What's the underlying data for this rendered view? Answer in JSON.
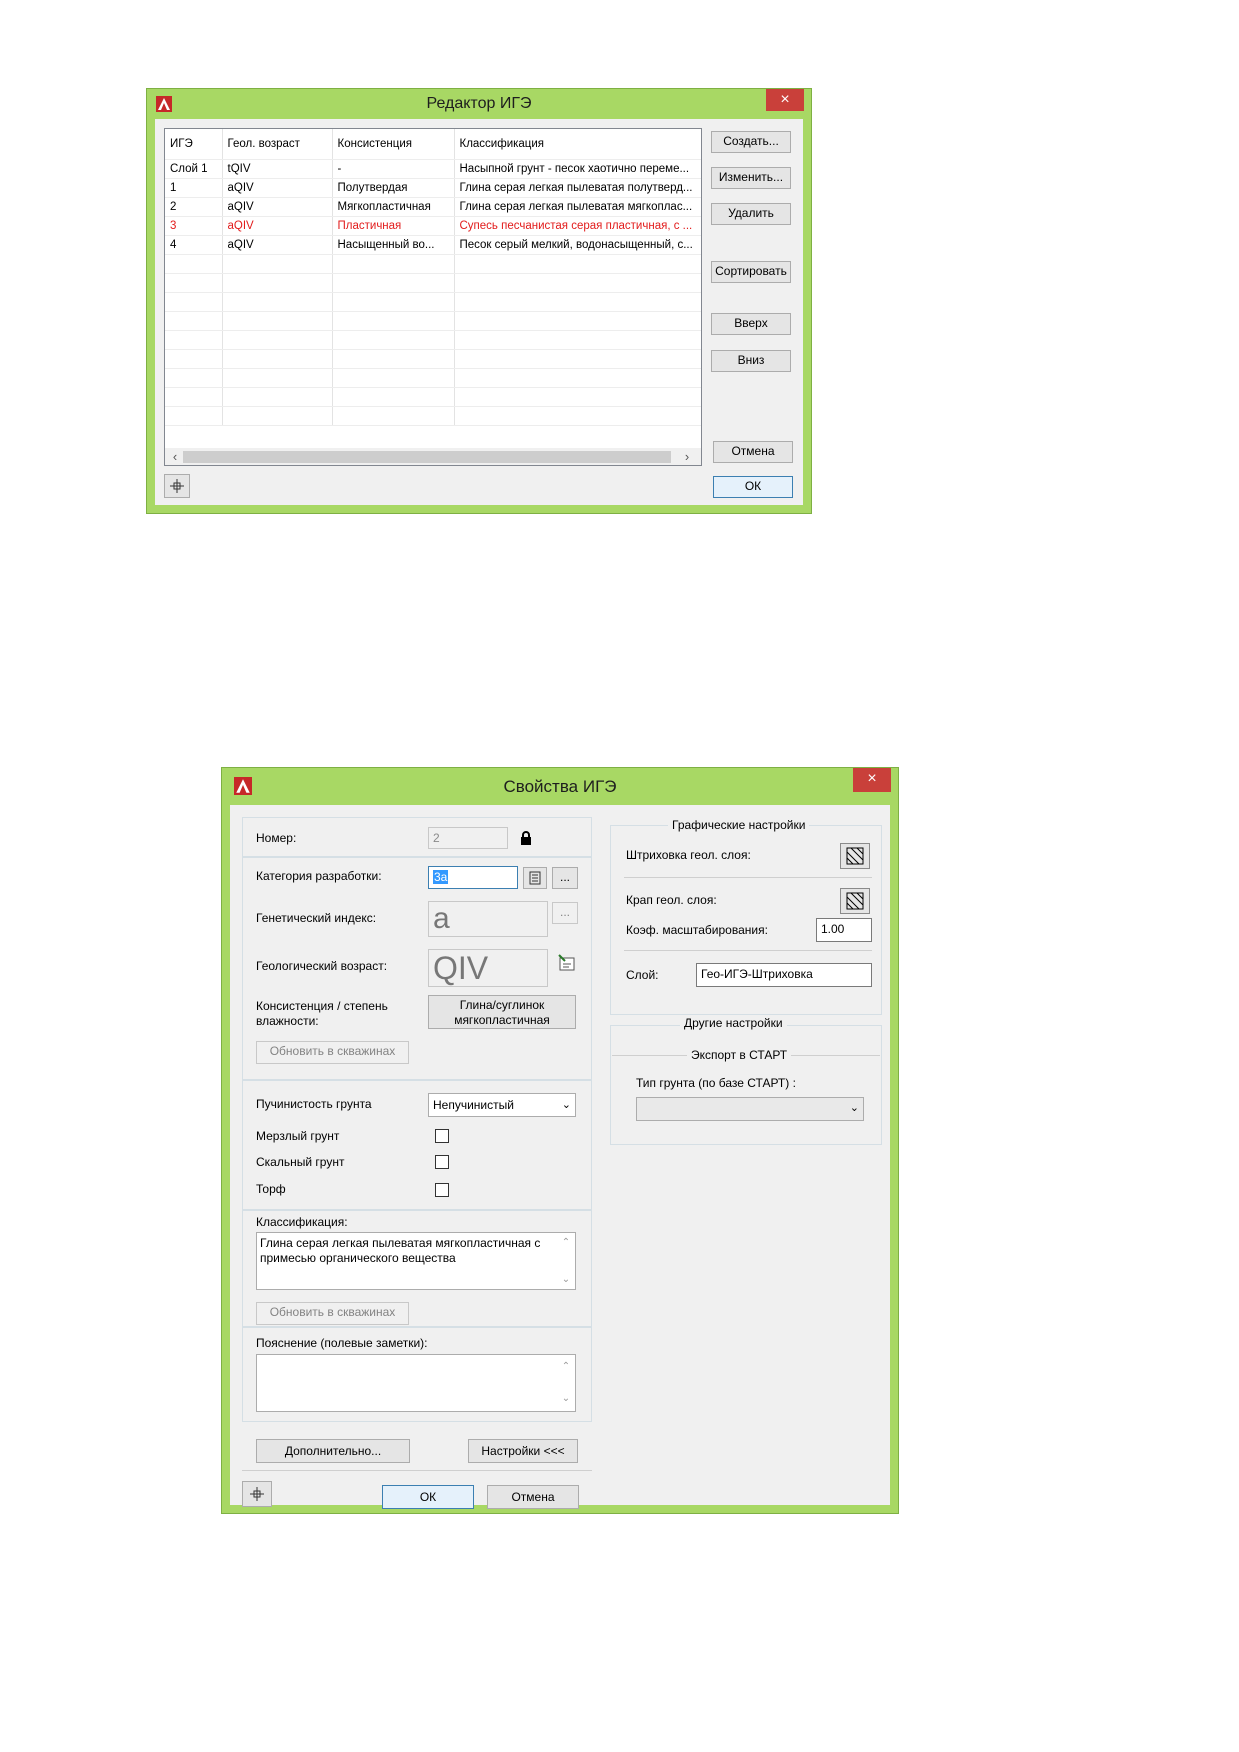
{
  "editor": {
    "title": "Редактор ИГЭ",
    "close": "×",
    "columns": [
      "ИГЭ",
      "Геол. возраст",
      "Консистенция",
      "Классификация"
    ],
    "rows": [
      {
        "ige": "Слой 1",
        "age": "tQIV",
        "cons": "-",
        "cls": "Насыпной грунт - песок хаотично переме..."
      },
      {
        "ige": "1",
        "age": "aQIV",
        "cons": "Полутвердая",
        "cls": "Глина серая легкая пылеватая полутверд..."
      },
      {
        "ige": "2",
        "age": "aQIV",
        "cons": "Мягкопластичная",
        "cls": "Глина серая легкая пылеватая мягкоплас..."
      },
      {
        "ige": "3",
        "age": "aQIV",
        "cons": "Пластичная",
        "cls": "Супесь песчанистая серая пластичная, с ..."
      },
      {
        "ige": "4",
        "age": "aQIV",
        "cons": "Насыщенный во...",
        "cls": "Песок серый мелкий, водонасыщенный, с..."
      }
    ],
    "highlight_color": "#e21b1b",
    "buttons": {
      "create": "Создать...",
      "edit": "Изменить...",
      "delete": "Удалить",
      "sort": "Сортировать",
      "up": "Вверх",
      "down": "Вниз",
      "cancel": "Отмена",
      "ok": "ОК"
    },
    "scroll_left": "‹",
    "scroll_right": "›"
  },
  "props": {
    "title": "Свойства ИГЭ",
    "close": "×",
    "number_label": "Номер:",
    "number_value": "2",
    "category_label": "Категория разработки:",
    "category_value": "3а",
    "genetic_label": "Генетический индекс:",
    "genetic_value": "a",
    "age_label": "Геологический возраст:",
    "age_value": "QIV",
    "consistency_label_1": "Консистенция / степень",
    "consistency_label_2": "влажности:",
    "consistency_btn_1": "Глина/суглинок",
    "consistency_btn_2": "мягкопластичная",
    "update_wells": "Обновить в скважинах",
    "heaving_label": "Пучинистость грунта",
    "heaving_value": "Непучинистый",
    "frozen_label": "Мерзлый грунт",
    "rocky_label": "Скальный грунт",
    "peat_label": "Торф",
    "classification_label": "Классификация:",
    "classification_text": "Глина серая легкая пылеватая мягкопластичная с примесью органического вещества",
    "update_wells_2": "Обновить в скважинах",
    "notes_label": "Пояснение (полевые заметки):",
    "notes_text": "",
    "more_btn": "Дополнительно...",
    "settings_btn": "Настройки <<<",
    "ok_btn": "ОК",
    "cancel_btn": "Отмена",
    "graphics_title": "Графические настройки",
    "hatch_label": "Штриховка геол. слоя:",
    "edge_label": "Крап геол. слоя:",
    "scale_label": "Коэф. масштабирования:",
    "scale_value": "1.00",
    "layer_label": "Слой:",
    "layer_value": "Гео-ИГЭ-Штриховка",
    "other_title": "Другие настройки",
    "export_title": "Экспорт в СТАРТ",
    "soil_type_label": "Тип грунта (по базе СТАРТ) :",
    "soil_type_value": ""
  }
}
